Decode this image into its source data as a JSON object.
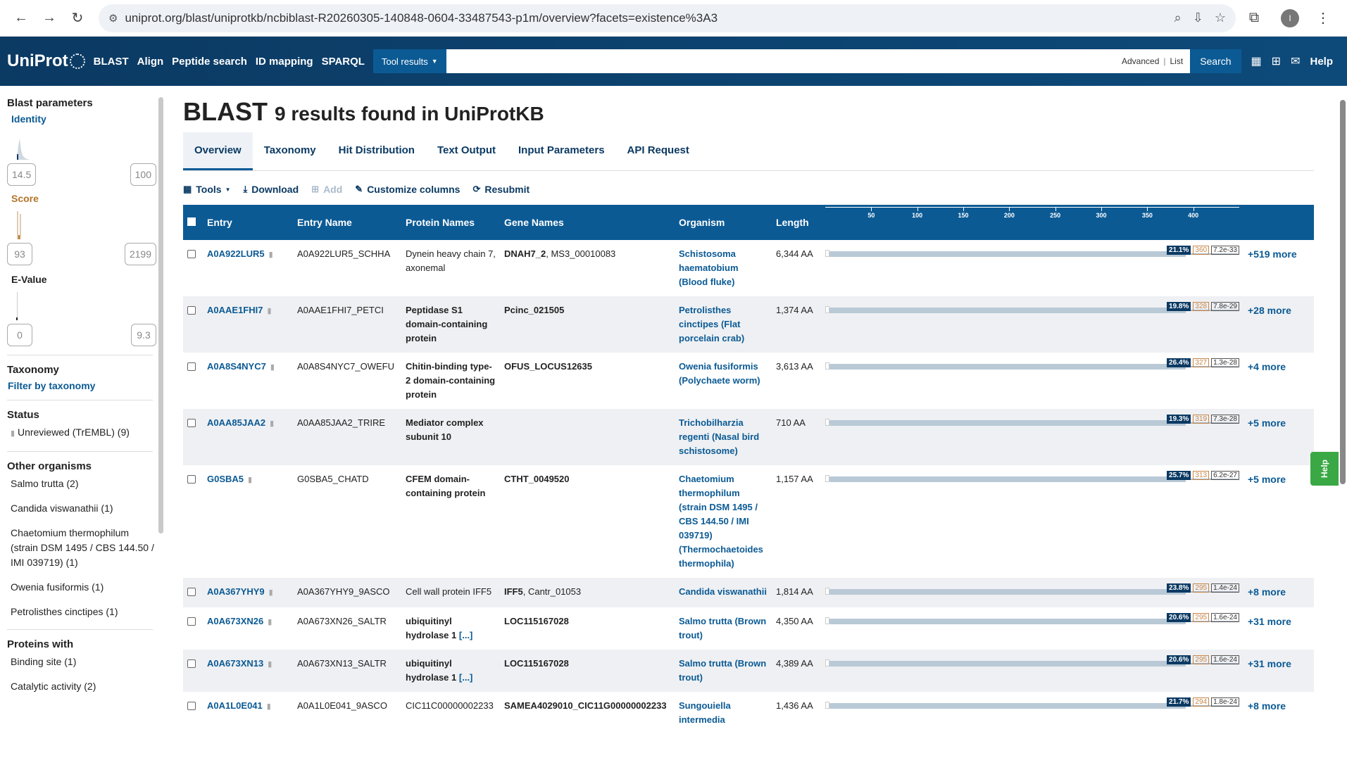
{
  "browser": {
    "url": "uniprot.org/blast/uniprotkb/ncbiblast-R20260305-140848-0604-33487543-p1m/overview?facets=existence%3A3",
    "avatar_letter": "I"
  },
  "header": {
    "logo": "UniProt",
    "nav": [
      "BLAST",
      "Align",
      "Peptide search",
      "ID mapping",
      "SPARQL"
    ],
    "tool_results": "Tool results",
    "advanced": "Advanced",
    "separator": "|",
    "list": "List",
    "search": "Search",
    "help": "Help"
  },
  "sidebar": {
    "blast_params_title": "Blast parameters",
    "identity_label": "Identity",
    "identity_min": "14.5",
    "identity_max": "100",
    "score_label": "Score",
    "score_min": "93",
    "score_max": "2199",
    "evalue_label": "E-Value",
    "evalue_min": "0",
    "evalue_max": "9.3",
    "taxonomy_title": "Taxonomy",
    "taxonomy_link": "Filter by taxonomy",
    "status_title": "Status",
    "status_item": "Unreviewed (TrEMBL) (9)",
    "other_org_title": "Other organisms",
    "other_orgs": [
      "Salmo trutta (2)",
      "Candida viswanathii (1)",
      "Chaetomium thermophilum (strain DSM 1495 / CBS 144.50 / IMI 039719) (1)",
      "Owenia fusiformis (1)",
      "Petrolisthes cinctipes (1)"
    ],
    "proteins_with_title": "Proteins with",
    "proteins_with": [
      "Binding site (1)",
      "Catalytic activity (2)"
    ]
  },
  "main": {
    "title": "BLAST",
    "subtitle": "9 results found in UniProtKB",
    "tabs": [
      "Overview",
      "Taxonomy",
      "Hit Distribution",
      "Text Output",
      "Input Parameters",
      "API Request"
    ],
    "toolbar": {
      "tools": "Tools",
      "download": "Download",
      "add": "Add",
      "customize": "Customize columns",
      "resubmit": "Resubmit"
    },
    "columns": [
      "Entry",
      "Entry Name",
      "Protein Names",
      "Gene Names",
      "Organism",
      "Length"
    ],
    "axis_ticks": [
      "50",
      "100",
      "150",
      "200",
      "250",
      "300",
      "350",
      "400"
    ],
    "help_tab": "Help"
  },
  "rows": [
    {
      "entry": "A0A922LUR5",
      "entry_name": "A0A922LUR5_SCHHA",
      "protein": "Dynein heavy chain 7, axonemal",
      "protein_bold": false,
      "gene_bold": "DNAH7_2",
      "gene_rest": ", MS3_00010083",
      "organism": "Schistosoma haematobium (Blood fluke)",
      "length": "6,344 AA",
      "identity": "21.1%",
      "score": "360",
      "evalue": "7.2e-33",
      "more": "+519 more",
      "bar_start": 0.01,
      "bar_end": 0.87
    },
    {
      "entry": "A0AAE1FHI7",
      "entry_name": "A0AAE1FHI7_PETCI",
      "protein": "Peptidase S1 domain-containing protein",
      "protein_bold": true,
      "gene_bold": "Pcinc_021505",
      "gene_rest": "",
      "organism": "Petrolisthes cinctipes (Flat porcelain crab)",
      "length": "1,374 AA",
      "identity": "19.8%",
      "score": "328",
      "evalue": "7.8e-29",
      "more": "+28 more",
      "bar_start": 0.01,
      "bar_end": 0.87
    },
    {
      "entry": "A0A8S4NYC7",
      "entry_name": "A0A8S4NYC7_OWEFU",
      "protein": "Chitin-binding type-2 domain-containing protein",
      "protein_bold": true,
      "gene_bold": "OFUS_LOCUS12635",
      "gene_rest": "",
      "organism": "Owenia fusiformis (Polychaete worm)",
      "length": "3,613 AA",
      "identity": "26.4%",
      "score": "327",
      "evalue": "1.3e-28",
      "more": "+4 more",
      "bar_start": 0.01,
      "bar_end": 0.87
    },
    {
      "entry": "A0AA85JAA2",
      "entry_name": "A0AA85JAA2_TRIRE",
      "protein": "Mediator complex subunit 10",
      "protein_bold": true,
      "gene_bold": "",
      "gene_rest": "",
      "organism": "Trichobilharzia regenti (Nasal bird schistosome)",
      "length": "710 AA",
      "identity": "19.3%",
      "score": "319",
      "evalue": "7.3e-28",
      "more": "+5 more",
      "bar_start": 0.01,
      "bar_end": 0.87
    },
    {
      "entry": "G0SBA5",
      "entry_name": "G0SBA5_CHATD",
      "protein": "CFEM domain-containing protein",
      "protein_bold": true,
      "gene_bold": "CTHT_0049520",
      "gene_rest": "",
      "organism": "Chaetomium thermophilum (strain DSM 1495 / CBS 144.50 / IMI 039719) (Thermochaetoides thermophila)",
      "length": "1,157 AA",
      "identity": "25.7%",
      "score": "313",
      "evalue": "6.2e-27",
      "more": "+5 more",
      "bar_start": 0.01,
      "bar_end": 0.87
    },
    {
      "entry": "A0A367YHY9",
      "entry_name": "A0A367YHY9_9ASCO",
      "protein": "Cell wall protein IFF5",
      "protein_bold": false,
      "gene_bold": "IFF5",
      "gene_rest": ", Cantr_01053",
      "organism": "Candida viswanathii",
      "length": "1,814 AA",
      "identity": "23.8%",
      "score": "295",
      "evalue": "1.4e-24",
      "more": "+8 more",
      "bar_start": 0.01,
      "bar_end": 0.87
    },
    {
      "entry": "A0A673XN26",
      "entry_name": "A0A673XN26_SALTR",
      "protein": "ubiquitinyl hydrolase 1",
      "protein_bold": true,
      "protein_more": "[...]",
      "gene_bold": "LOC115167028",
      "gene_rest": "",
      "organism": "Salmo trutta (Brown trout)",
      "length": "4,350 AA",
      "identity": "20.6%",
      "score": "295",
      "evalue": "1.6e-24",
      "more": "+31 more",
      "bar_start": 0.01,
      "bar_end": 0.87
    },
    {
      "entry": "A0A673XN13",
      "entry_name": "A0A673XN13_SALTR",
      "protein": "ubiquitinyl hydrolase 1",
      "protein_bold": true,
      "protein_more": "[...]",
      "gene_bold": "LOC115167028",
      "gene_rest": "",
      "organism": "Salmo trutta (Brown trout)",
      "length": "4,389 AA",
      "identity": "20.6%",
      "score": "295",
      "evalue": "1.6e-24",
      "more": "+31 more",
      "bar_start": 0.01,
      "bar_end": 0.87
    },
    {
      "entry": "A0A1L0E041",
      "entry_name": "A0A1L0E041_9ASCO",
      "protein": "CIC11C00000002233",
      "protein_bold": false,
      "gene_bold": "SAMEA4029010_CIC11G00000002233",
      "gene_rest": "",
      "organism": "Sungouiella intermedia",
      "length": "1,436 AA",
      "identity": "21.7%",
      "score": "294",
      "evalue": "1.8e-24",
      "more": "+8 more",
      "bar_start": 0.01,
      "bar_end": 0.87
    }
  ],
  "colors": {
    "header_bg": "#0b3a63",
    "accent": "#0b5a94",
    "help_green": "#3aa845",
    "score_orange": "#c8874a"
  }
}
